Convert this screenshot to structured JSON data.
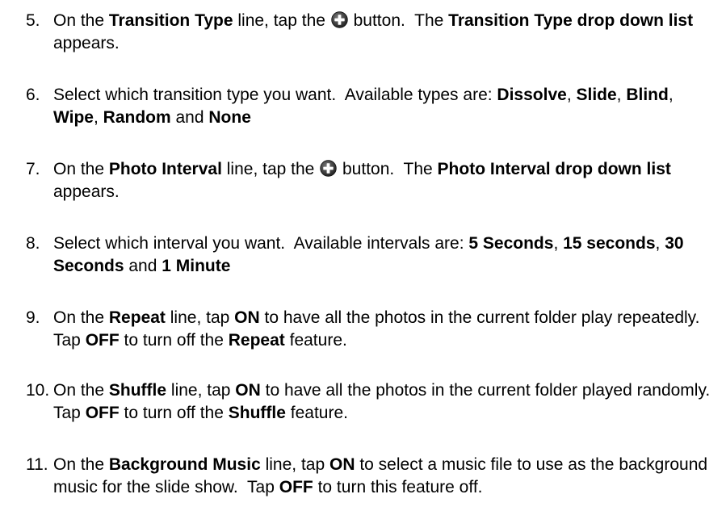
{
  "steps": [
    {
      "number": "5.",
      "segments": [
        {
          "t": "On the ",
          "b": false
        },
        {
          "t": "Transition Type",
          "b": true
        },
        {
          "t": " line, tap the ",
          "b": false
        },
        {
          "icon": "plus-circle-icon"
        },
        {
          "t": " button.  The ",
          "b": false
        },
        {
          "t": "Transition Type drop down list",
          "b": true
        },
        {
          "t": " appears.",
          "b": false
        }
      ]
    },
    {
      "number": "6.",
      "segments": [
        {
          "t": "Select which transition type you want.  Available types are: ",
          "b": false
        },
        {
          "t": "Dissolve",
          "b": true
        },
        {
          "t": ", ",
          "b": false
        },
        {
          "t": "Slide",
          "b": true
        },
        {
          "t": ", ",
          "b": false
        },
        {
          "t": "Blind",
          "b": true
        },
        {
          "t": ", ",
          "b": false
        },
        {
          "t": "Wipe",
          "b": true
        },
        {
          "t": ", ",
          "b": false
        },
        {
          "t": "Random",
          "b": true
        },
        {
          "t": " and ",
          "b": false
        },
        {
          "t": "None",
          "b": true
        }
      ]
    },
    {
      "number": "7.",
      "segments": [
        {
          "t": "On the ",
          "b": false
        },
        {
          "t": "Photo Interval",
          "b": true
        },
        {
          "t": " line, tap the ",
          "b": false
        },
        {
          "icon": "plus-circle-icon"
        },
        {
          "t": " button.  The ",
          "b": false
        },
        {
          "t": "Photo Interval drop down list",
          "b": true
        },
        {
          "t": " appears.",
          "b": false
        }
      ]
    },
    {
      "number": "8.",
      "segments": [
        {
          "t": "Select which interval you want.  Available intervals are: ",
          "b": false
        },
        {
          "t": "5 Seconds",
          "b": true
        },
        {
          "t": ", ",
          "b": false
        },
        {
          "t": "15 seconds",
          "b": true
        },
        {
          "t": ", ",
          "b": false
        },
        {
          "t": "30 Seconds",
          "b": true
        },
        {
          "t": " and ",
          "b": false
        },
        {
          "t": "1 Minute",
          "b": true
        }
      ]
    },
    {
      "number": "9.",
      "segments": [
        {
          "t": "On the ",
          "b": false
        },
        {
          "t": "Repeat",
          "b": true
        },
        {
          "t": " line, tap ",
          "b": false
        },
        {
          "t": "ON",
          "b": true
        },
        {
          "t": " to have all the photos in the current folder play repeatedly.  Tap ",
          "b": false
        },
        {
          "t": "OFF",
          "b": true
        },
        {
          "t": " to turn off the ",
          "b": false
        },
        {
          "t": "Repeat",
          "b": true
        },
        {
          "t": " feature.",
          "b": false
        }
      ]
    },
    {
      "number": "10.",
      "segments": [
        {
          "t": "On the ",
          "b": false
        },
        {
          "t": "Shuffle",
          "b": true
        },
        {
          "t": " line, tap ",
          "b": false
        },
        {
          "t": "ON",
          "b": true
        },
        {
          "t": " to have all the photos in the current folder played randomly.  Tap ",
          "b": false
        },
        {
          "t": "OFF",
          "b": true
        },
        {
          "t": " to turn off the ",
          "b": false
        },
        {
          "t": "Shuffle",
          "b": true
        },
        {
          "t": " feature.",
          "b": false
        }
      ]
    },
    {
      "number": "11.",
      "segments": [
        {
          "t": "On the ",
          "b": false
        },
        {
          "t": "Background Music",
          "b": true
        },
        {
          "t": " line, tap ",
          "b": false
        },
        {
          "t": "ON",
          "b": true
        },
        {
          "t": " to select a music file to use as the background music for the slide show.  Tap ",
          "b": false
        },
        {
          "t": "OFF",
          "b": true
        },
        {
          "t": " to turn this feature off.",
          "b": false
        }
      ]
    }
  ]
}
